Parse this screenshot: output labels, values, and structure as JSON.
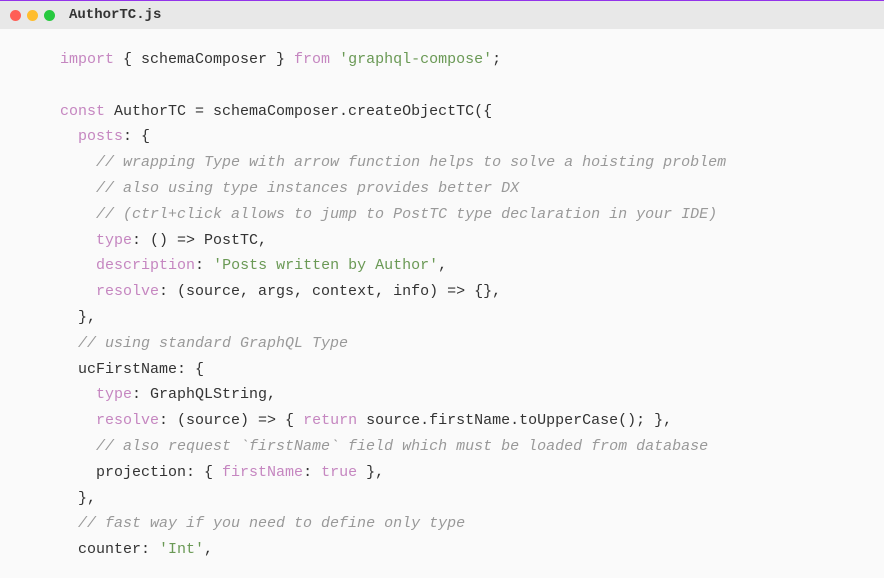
{
  "titlebar": {
    "filename": "AuthorTC.js"
  },
  "code": {
    "l1_import": "import",
    "l1_schemaComposer": " { schemaComposer } ",
    "l1_from": "from",
    "l1_pkg": " 'graphql-compose'",
    "l1_semi": ";",
    "l3_const": "const",
    "l3_rest": " AuthorTC = schemaComposer.createObjectTC({",
    "l4_prop": "posts",
    "l4_rest": ": {",
    "l5_comment": "// wrapping Type with arrow function helps to solve a hoisting problem",
    "l6_comment": "// also using type instances provides better DX",
    "l7_comment": "// (ctrl+click allows to jump to PostTC type declaration in your IDE)",
    "l8_prop": "type",
    "l8_rest": ": () => PostTC,",
    "l9_prop": "description",
    "l9_colon": ": ",
    "l9_str": "'Posts written by Author'",
    "l9_comma": ",",
    "l10_prop": "resolve",
    "l10_rest": ": (source, args, context, info) => {},",
    "l11": "},",
    "l12_comment": "// using standard GraphQL Type",
    "l13_rest": "ucFirstName: {",
    "l14_prop": "type",
    "l14_rest": ": GraphQLString,",
    "l15_prop": "resolve",
    "l15_mid1": ": (source) => { ",
    "l15_return": "return",
    "l15_mid2": " source.firstName.toUpperCase(); },",
    "l16_comment": "// also request `firstName` field which must be loaded from database",
    "l17_pre": "projection: { ",
    "l17_prop": "firstName",
    "l17_mid": ": ",
    "l17_bool": "true",
    "l17_end": " },",
    "l18": "},",
    "l19_comment": "// fast way if you need to define only type",
    "l20_pre": "counter: ",
    "l20_str": "'Int'",
    "l20_end": ","
  }
}
